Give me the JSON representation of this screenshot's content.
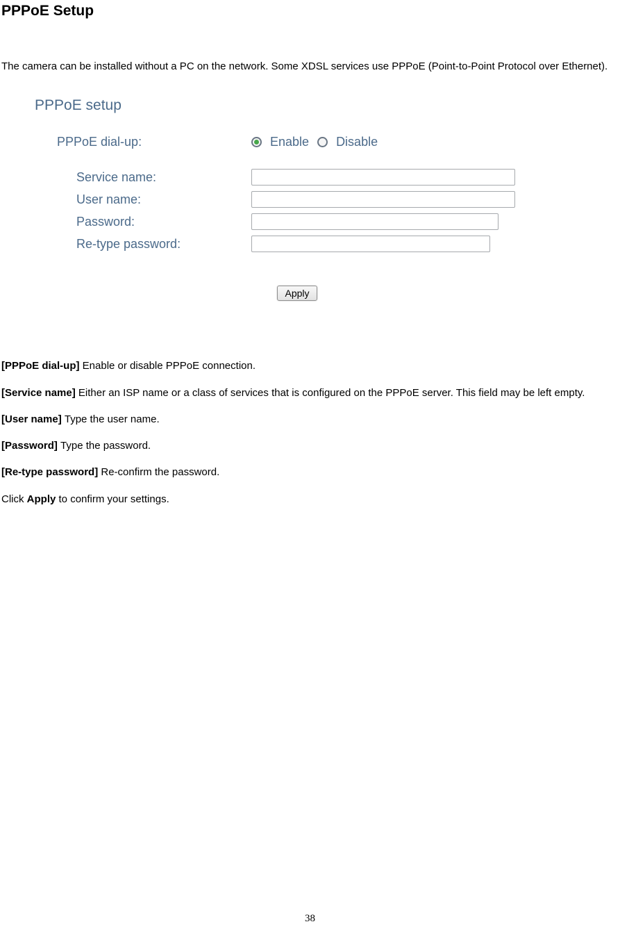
{
  "page": {
    "title": "PPPoE Setup",
    "intro": "The camera can be installed without a PC on the network. Some XDSL services use PPPoE (Point-to-Point Protocol over Ethernet).",
    "page_number": "38"
  },
  "form": {
    "legend": "PPPoE setup",
    "dialup_label": "PPPoE dial-up:",
    "enable_label": "Enable",
    "disable_label": "Disable",
    "service_label": "Service name:",
    "username_label": "User name:",
    "password_label": "Password:",
    "retype_label": "Re-type password:",
    "apply_label": "Apply",
    "values": {
      "service": "",
      "username": "",
      "password": "",
      "retype": ""
    }
  },
  "desc": {
    "dialup_key": "[PPPoE dial-up] ",
    "dialup_text": "Enable or disable PPPoE connection.",
    "service_key": "[Service name] ",
    "service_text": "Either an ISP name or a class of services that is configured on the PPPoE server. This field may be left empty.",
    "username_key": "[User name] ",
    "username_text": "Type the user name.",
    "password_key": "[Password] ",
    "password_text": "Type the password.",
    "retype_key": "[Re-type password] ",
    "retype_text": "Re-confirm the password.",
    "apply_pre": "Click ",
    "apply_bold": "Apply",
    "apply_post": " to confirm your settings."
  }
}
